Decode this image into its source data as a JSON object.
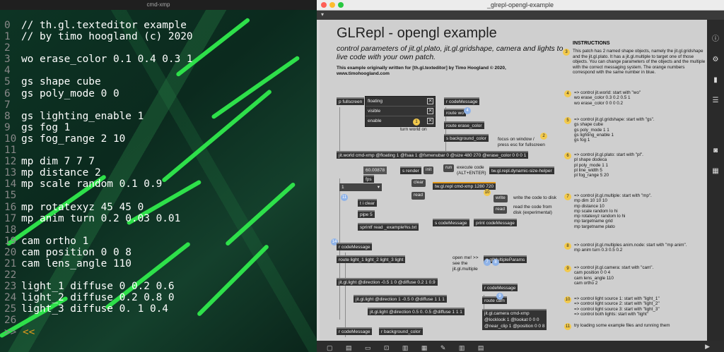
{
  "left_window": {
    "title": "cmd-xmp",
    "lines": [
      {
        "n": "0",
        "text": "// th.gl.texteditor example"
      },
      {
        "n": "1",
        "text": "// by timo hoogland (c) 2020"
      },
      {
        "n": "2",
        "text": ""
      },
      {
        "n": "3",
        "text": "wo erase_color 0.1 0.4 0.3 1"
      },
      {
        "n": "4",
        "text": ""
      },
      {
        "n": "5",
        "text": "gs shape cube"
      },
      {
        "n": "6",
        "text": "gs poly_mode 0 0"
      },
      {
        "n": "7",
        "text": ""
      },
      {
        "n": "8",
        "text": "gs lighting_enable 1"
      },
      {
        "n": "9",
        "text": "gs fog 1"
      },
      {
        "n": "10",
        "text": "gs fog_range 2 10"
      },
      {
        "n": "11",
        "text": ""
      },
      {
        "n": "12",
        "text": "mp dim 7 7 7"
      },
      {
        "n": "13",
        "text": "mp distance 2"
      },
      {
        "n": "14",
        "text": "mp scale random 0.1 0.9"
      },
      {
        "n": "15",
        "text": ""
      },
      {
        "n": "16",
        "text": "mp rotatexyz 45 45 0"
      },
      {
        "n": "17",
        "text": "mp anim turn 0.2 0.03 0.01"
      },
      {
        "n": "18",
        "text": ""
      },
      {
        "n": "19",
        "text": "cam ortho 1"
      },
      {
        "n": "20",
        "text": "cam position 0 0 8"
      },
      {
        "n": "21",
        "text": "cam lens_angle 110"
      },
      {
        "n": "22",
        "text": ""
      },
      {
        "n": "23",
        "text": "light_1 diffuse 0 0.2 0.6"
      },
      {
        "n": "24",
        "text": "light_2 diffuse 0.2 0.8 0"
      },
      {
        "n": "25",
        "text": "light_3 diffuse 0. 1 0.4"
      },
      {
        "n": "26",
        "text": ""
      }
    ],
    "prompt": ">>",
    "prompt_arrows": "<<"
  },
  "right_window": {
    "title": "_glrepl-opengl-example",
    "heading": "GLRepl - opengl example",
    "subtitle": "control parameters of jit.gl.plato, jit.gl.gridshape, camera and lights to live code with your own patch.",
    "note_line1": "This example originally written for [th.gl.texteditor]  by Timo Hoogland © 2020,",
    "note_line2": "www.timohoogland.com",
    "objects": {
      "p_fullscreen": "p fullscreen",
      "floating": "floating",
      "visible": "visible",
      "enable": "enable",
      "turn_world_on": "turn world on",
      "r_codeMessage_1": "r codeMessage",
      "route_wo": "route wo",
      "route_erase_color": "route erase_color",
      "s_background_color": "s background_color",
      "focus_note": "focus on window /\npress esc for fullscreen",
      "jit_world": "jit.world cmd-xmp @floating 1 @fsaa 1 @fsmenubar 0 @size 480 270 @erase_color 0 0 0 1",
      "fps_num": "60.00878",
      "fps": "fps",
      "s_render": "s render",
      "init": "init",
      "run": "run",
      "execute_note": "execute code\n(ALT+ENTER)",
      "resize_helper": "tw.gl.repl.dynamic-size-helper",
      "menu_val": "1",
      "clear": "clear",
      "read": "read",
      "tw_repl": "tw.gl.repl cmd-xmp 1280 720",
      "t_i_clear": "t i clear",
      "write": "write",
      "write_note": "write the code to disk",
      "read2": "read",
      "read_note": "read the code from\ndisk (experimental)",
      "pipe": "pipe 5",
      "sprintf": "sprintf read _example%s.txt",
      "s_codeMessage": "s codeMessage",
      "print_codeMessage": "print codeMessage",
      "r_codeMessage_2": "r codeMessage",
      "route_lights": "route light_1 light_2 light_3 light",
      "open_note": "open me! >>\nsee the\njit.gl.multiple",
      "p_multiple": "p glMultipleParams",
      "light1": "jit.gl.light @direction -0.5 1 0 @diffuse 0.2 1 0.9",
      "light2": "jit.gl.light @direction 1 -0.5 0 @diffuse 1 1 1",
      "light3": "jit.gl.light @direction 0.5 0. 0.5 @diffuse 1 1 1",
      "r_codeMessage_3": "r codeMessage",
      "route_cam": "route cam",
      "jit_camera": "jit.gl.camera cmd-xmp\n@locklook 1 @lookat 0 0 0\n@near_clip 1 @position 0 0 8",
      "r_codeMessage_4": "r codeMessage",
      "r_background_color": "r background_color"
    },
    "badges": {
      "b1": "1",
      "b2": "2",
      "b3": "3",
      "b4": "4",
      "b10": "10",
      "b11": "11",
      "b14": "14",
      "b15": "15"
    },
    "instructions": {
      "title": "INSTRUCTIONS",
      "i3": "This patch has 2 named shape objects, namely the jit.gl.gridshape and the jit.gl.plato. It has a jit.gl.multiple to target one of those objects. You can change parameters of the objects and the multiple with the correct messaging system. The orange numbers correspond with the same number in blue.",
      "i4": "=> control jit.world: start with \"wo\"\nwo erase_color 0.3 0.2 0.5 1\nwo erase_color 0 0 0 0.2",
      "i5": "=> control jit.gl.gridshape: start with \"gs\".\ngs shape cube\ngs poly_mode 1 1\ngs lighting_enable 1\ngs fog 1",
      "i6": "=> control jit.gl.plato: start with \"pl\".\npl shape dodeca\npl poly_mode 1 1\npl line_width 5\npl fog_range 5 20",
      "i7": "=> control jit.gl.multiple: start with \"mp\".\nmp dim 10 10 10\nmp distance 10\nmp scale random lo hi\nmp rotatexyz random lo hi\nmp targetname grid\nmp targetname plato",
      "i8": "=> control jit.gl.multiples anim.node: start with \"mp anim\".\nmp anim turn 0.3 0.5 0.2",
      "i9": "=> control jit.gl.camera: start with \"cam\".\ncam position 0 0 4\ncam lens_angle 110\ncam ortho 2",
      "i10": "=> control light source 1: start with \"light_1\"\n=> control light source 2: start with \"light_2\"\n=> control light source 3: start with \"light_3\"\n=> control both lights: start with \"light\"",
      "i11": "try loading some example files and running them",
      "n4": "4",
      "n5": "5",
      "n6": "6",
      "n7": "7",
      "n8": "8",
      "n9": "9",
      "n10": "10",
      "n11": "11"
    }
  },
  "colors": {
    "code_bg": "#0c2a1f",
    "leaf_green": "#2ee04a",
    "badge_yellow": "#f2c94c",
    "badge_blue": "#8fb3e8",
    "prompt_orange": "#e39a1c"
  }
}
